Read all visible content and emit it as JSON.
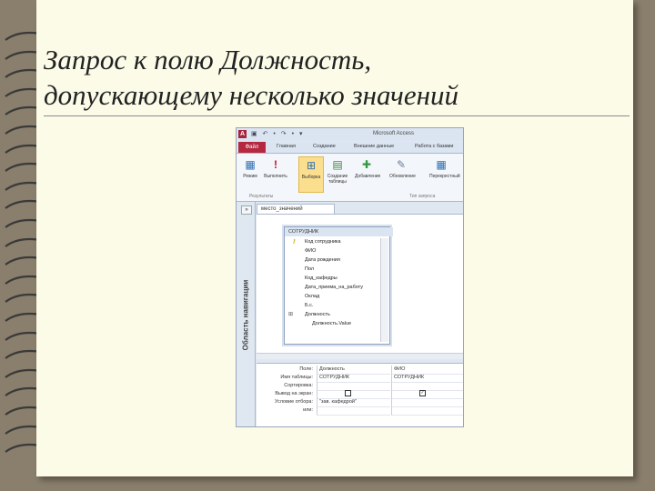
{
  "slide": {
    "title_line1": "Запрос к полю Должность,",
    "title_line2": "допускающему несколько значений"
  },
  "window": {
    "app_icon": "A",
    "title": "Microsoft Access",
    "quick_access": "▣ ↶ • ↷ • ▾"
  },
  "tabs": [
    "Файл",
    "Главная",
    "Создание",
    "Внешние данные",
    "Работа с базами"
  ],
  "ribbon": {
    "buttons": [
      {
        "label": "Режим",
        "icon": "table-icon"
      },
      {
        "label": "Выполнить",
        "icon": "exclamation-icon"
      },
      {
        "label": "Выборка",
        "icon": "grid-select-icon"
      },
      {
        "label": "Создание таблицы",
        "icon": "make-table-icon"
      },
      {
        "label": "Добавление",
        "icon": "append-icon"
      },
      {
        "label": "Обновление",
        "icon": "pencil-icon"
      },
      {
        "label": "Перекрестный",
        "icon": "crosstab-icon"
      }
    ],
    "group_results": "Результаты",
    "group_query_type": "Тип запроса"
  },
  "nav_pane": {
    "label": "Область навигации",
    "toggle": "»"
  },
  "query_tab": "место_значений",
  "table": {
    "name": "СОТРУДНИК",
    "fields": [
      "Код сотрудника",
      "ФИО",
      "Дата рождения",
      "Пол",
      "Код_кафедры",
      "Дата_приема_на_работу",
      "Оклад",
      "Б.с.",
      "Должность",
      "Должность.Value"
    ]
  },
  "grid": {
    "rows": [
      {
        "label": "Поле:",
        "c1": "Должность",
        "c2": "ФИО"
      },
      {
        "label": "Имя таблицы:",
        "c1": "СОТРУДНИК",
        "c2": "СОТРУДНИК"
      },
      {
        "label": "Сортировка:",
        "c1": "",
        "c2": ""
      },
      {
        "label": "Вывод на экран:",
        "c1": "",
        "c2": ""
      },
      {
        "label": "Условие отбора:",
        "c1": "\"зав. кафедрой\"",
        "c2": ""
      },
      {
        "label": "или:",
        "c1": "",
        "c2": ""
      }
    ],
    "show": [
      false,
      true
    ]
  }
}
